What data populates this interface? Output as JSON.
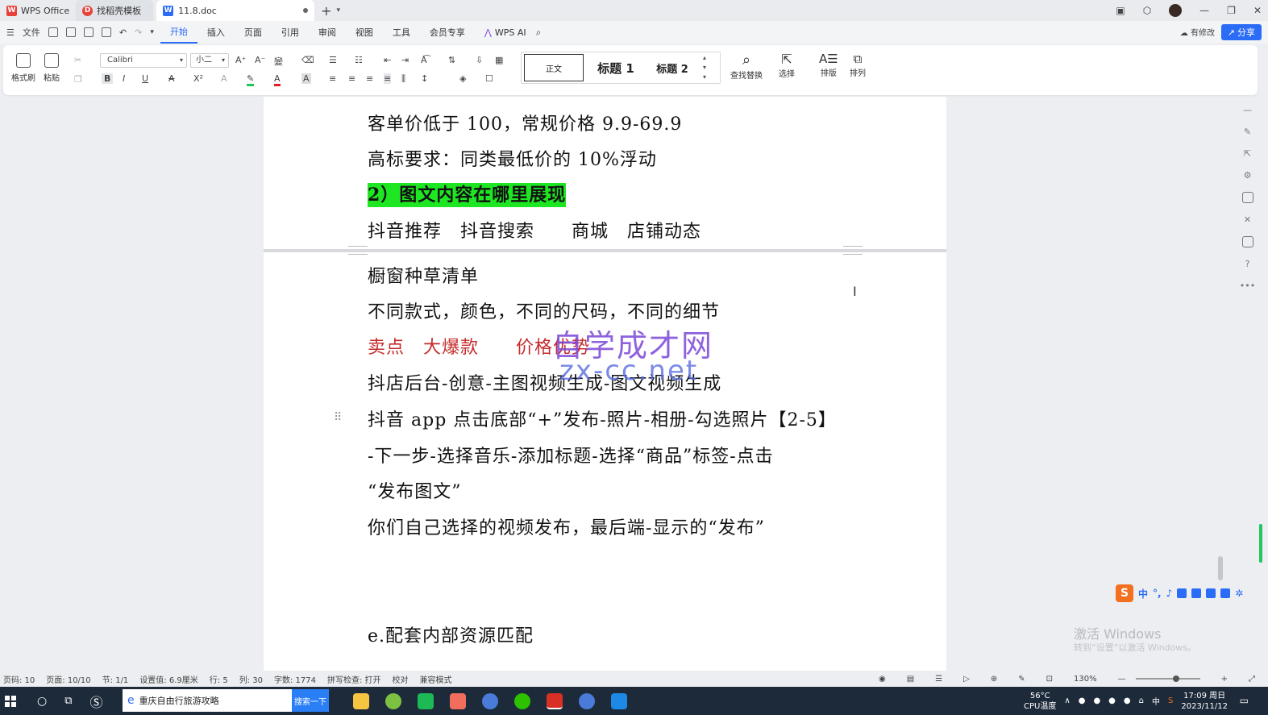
{
  "titlebar": {
    "app_tab": "WPS Office",
    "template_tab": "找稻壳模板",
    "doc_tab": "11.8.doc",
    "doc_icon": "W"
  },
  "menu": {
    "file": "文件",
    "items": [
      "开始",
      "插入",
      "页面",
      "引用",
      "审阅",
      "视图",
      "工具",
      "会员专享"
    ],
    "ai": "WPS AI",
    "has_changes": "有修改",
    "share": "分享"
  },
  "ribbon": {
    "format_painter": "格式刷",
    "paste": "粘贴",
    "font_name": "Calibri",
    "font_size": "小二",
    "styles": {
      "normal": "正文",
      "h1": "标题 1",
      "h2": "标题 2"
    },
    "find_replace": "查找替换",
    "select": "选择",
    "layout": "排版",
    "arrange": "排列"
  },
  "document": {
    "page1_lines": [
      "客单价低于 100，常规价格 9.9-69.9",
      "高标要求：同类最低价的 10%浮动",
      "2）图文内容在哪里展现",
      "抖音推荐　抖音搜索　　商城　店铺动态"
    ],
    "page2_lines": [
      "橱窗种草清单",
      "不同款式，颜色，不同的尺码，不同的细节",
      "卖点　大爆款　　价格优势",
      "抖店后台-创意-主图视频生成-图文视频生成",
      "抖音 app 点击底部“+”发布-照片-相册-勾选照片【2-5】",
      "-下一步-选择音乐-添加标题-选择“商品”标签-点击",
      "“发布图文”",
      "你们自己选择的视频发布，最后端-显示的“发布”",
      "e.配套内部资源匹配"
    ],
    "watermark_cn": "自学成才网",
    "watermark_en": "zx-cc.net"
  },
  "overlay": {
    "ime_char": "中",
    "activate_title": "激活 Windows",
    "activate_sub": "转到“设置”以激活 Windows。"
  },
  "statusbar": {
    "page_code": "页码: 10",
    "page": "页面: 10/10",
    "section": "节: 1/1",
    "setting": "设置值: 6.9厘米",
    "row": "行: 5",
    "col": "列: 30",
    "words": "字数: 1774",
    "spell": "拼写检查: 打开",
    "proof": "校对",
    "compat": "兼容模式",
    "zoom": "130%"
  },
  "taskbar": {
    "search_text": "重庆自由行旅游攻略",
    "search_button": "搜索一下",
    "temp": "56°C",
    "cpu": "CPU温度",
    "ime": "中",
    "time": "17:09 周日",
    "date": "2023/11/12"
  },
  "colors": {
    "accent": "#2b6cf6",
    "highlight": "#1ee622",
    "red_text": "#c62c2c"
  }
}
